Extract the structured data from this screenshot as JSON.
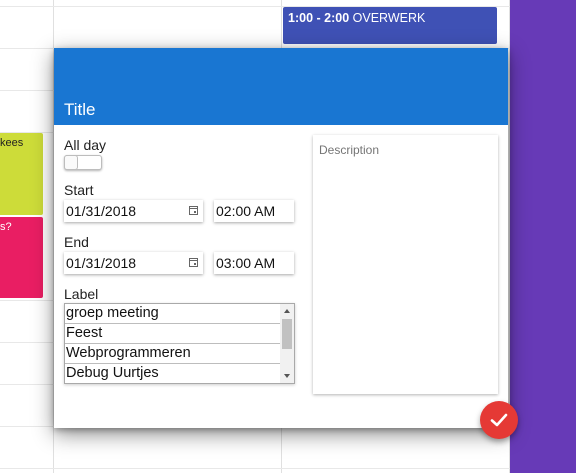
{
  "calendar": {
    "events": [
      {
        "time": "1:00 - 2:00",
        "title": "OVERWERK"
      },
      {
        "text": "kees"
      },
      {
        "text": "s?"
      }
    ]
  },
  "dialog": {
    "title": "Title",
    "all_day_label": "All day",
    "start_label": "Start",
    "start_date": "01/31/2018",
    "start_time": "02:00 AM",
    "end_label": "End",
    "end_date": "01/31/2018",
    "end_time": "03:00 AM",
    "label_label": "Label",
    "label_options": [
      "groep meeting",
      "Feest",
      "Webprogrammeren",
      "Debug Uurtjes"
    ],
    "description_placeholder": "Description"
  },
  "colors": {
    "header": "#1976d2",
    "event_blue": "#3f51b5",
    "event_lime": "#cddc39",
    "event_pink": "#e91e63",
    "sidebar_purple": "#673ab7",
    "fab": "#e53935"
  },
  "icons": {
    "calendar": "calendar-icon",
    "submit": "check-icon"
  }
}
